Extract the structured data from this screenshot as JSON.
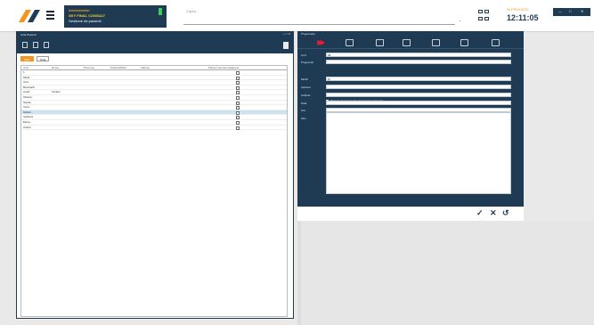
{
  "topbar": {
    "user_line1": "Aministrator",
    "user_line2": "SKY FINAL CONSULT",
    "user_line3": "Gestiune de pacienti",
    "search_placeholder": "Cauta...",
    "status_label": "IN PROCESS",
    "time": "12:11:05"
  },
  "left_window": {
    "title": "Grila Pacienti",
    "tabs": [
      {
        "label": "Filtre"
      },
      {
        "label": "Grila"
      }
    ],
    "columns": [
      "Cod",
      "Nume",
      "Prenume",
      "Telefon/Mobil",
      "Adresa",
      "Pacient permite tratament"
    ],
    "rows": [
      {
        "c1": "1",
        "c2": "",
        "c3": "",
        "c4": "",
        "c5": ""
      },
      {
        "c1": "Mihai",
        "c2": "",
        "c3": "",
        "c4": "",
        "c5": ""
      },
      {
        "c1": "Aron",
        "c2": "",
        "c3": "",
        "c4": "",
        "c5": ""
      },
      {
        "c1": "Bombardi",
        "c2": "",
        "c3": "",
        "c4": "",
        "c5": ""
      },
      {
        "c1": "Anelli",
        "c2": "Strudel",
        "c3": "",
        "c4": "",
        "c5": ""
      },
      {
        "c1": "Tatiana",
        "c2": "",
        "c3": "",
        "c4": "",
        "c5": ""
      },
      {
        "c1": "Sanda",
        "c2": "",
        "c3": "",
        "c4": "",
        "c5": ""
      },
      {
        "c1": "Voicu",
        "c2": "",
        "c3": "",
        "c4": "",
        "c5": ""
      },
      {
        "c1": "Stefan",
        "c2": "",
        "c3": "",
        "c4": "",
        "c5": ""
      },
      {
        "c1": "Stefania",
        "c2": "",
        "c3": "",
        "c4": "",
        "c5": ""
      },
      {
        "c1": "Elena",
        "c2": "",
        "c3": "",
        "c4": "",
        "c5": ""
      },
      {
        "c1": "Andrei",
        "c2": "",
        "c3": "",
        "c4": "",
        "c5": ""
      }
    ]
  },
  "right_window": {
    "title": "Programare",
    "fields": {
      "cod_label": "Cod",
      "cod_value": "99",
      "programat_label": "Programat",
      "programat_value": "",
      "checkbox_label": "Pacient programat din programul programari",
      "medic_label": "Medic",
      "medic_value": "Dr",
      "asistent_label": "Asistent",
      "cabinet_label": "Cabinet",
      "data_label": "Data",
      "ora_label": "Ora",
      "obs_label": "Obs."
    }
  },
  "colors": {
    "accent": "#f7941d",
    "navy": "#1f3b54",
    "danger": "#e01e37"
  }
}
